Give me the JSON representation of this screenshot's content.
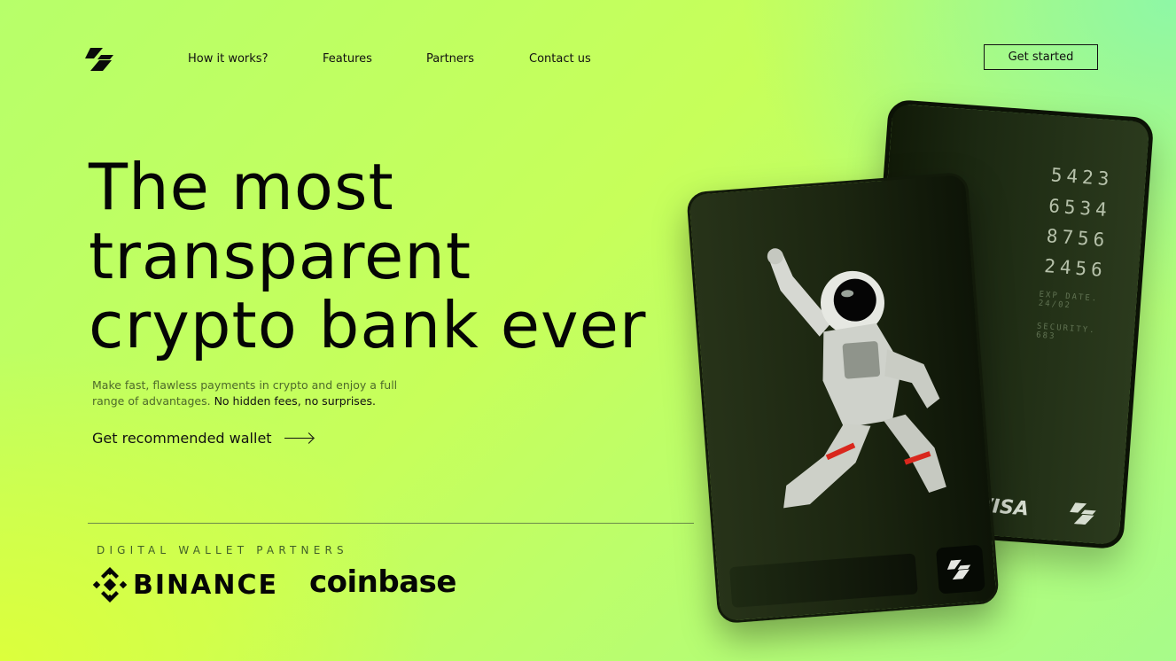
{
  "nav": {
    "items": [
      "How it works?",
      "Features",
      "Partners",
      "Contact us"
    ],
    "cta_label": "Get started"
  },
  "hero": {
    "title_lines": [
      "The most",
      "transparent",
      "crypto bank ever"
    ],
    "subtitle_muted": "Make fast, flawless payments in crypto and enjoy a full range of advantages.",
    "subtitle_strong": "No hidden fees, no surprises.",
    "wallet_link": "Get recommended wallet"
  },
  "partners": {
    "label": "DIGITAL WALLET PARTNERS",
    "logos": [
      "BINANCE",
      "coinbase"
    ]
  },
  "card": {
    "number_groups": [
      "5423",
      "6534",
      "8756",
      "2456"
    ],
    "exp_label": "EXP DATE.",
    "exp_value": "24/02",
    "security_label": "SECURITY.",
    "security_value": "683",
    "network": "VISA"
  },
  "icons": {
    "brand": "brand-logo-icon",
    "arrow": "arrow-right-icon",
    "binance": "binance-diamond-icon",
    "astronaut": "astronaut-illustration"
  },
  "colors": {
    "background_green": "#b7ff6a",
    "lime": "#dcff3c",
    "card_dark": "#1b2510",
    "text": "#050505"
  }
}
